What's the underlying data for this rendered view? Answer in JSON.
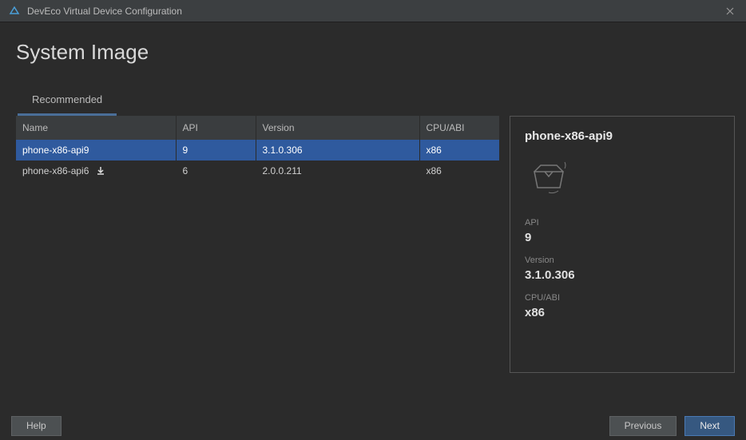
{
  "window": {
    "title": "DevEco Virtual Device Configuration"
  },
  "page": {
    "heading": "System Image"
  },
  "tabs": {
    "recommended": "Recommended"
  },
  "table": {
    "headers": {
      "name": "Name",
      "api": "API",
      "version": "Version",
      "cpu": "CPU/ABI"
    },
    "rows": [
      {
        "name": "phone-x86-api9",
        "api": "9",
        "version": "3.1.0.306",
        "cpu": "x86",
        "downloadable": false
      },
      {
        "name": "phone-x86-api6",
        "api": "6",
        "version": "2.0.0.211",
        "cpu": "x86",
        "downloadable": true
      }
    ]
  },
  "details": {
    "title": "phone-x86-api9",
    "api_label": "API",
    "api_value": "9",
    "version_label": "Version",
    "version_value": "3.1.0.306",
    "cpu_label": "CPU/ABI",
    "cpu_value": "x86"
  },
  "footer": {
    "help": "Help",
    "previous": "Previous",
    "next": "Next"
  }
}
